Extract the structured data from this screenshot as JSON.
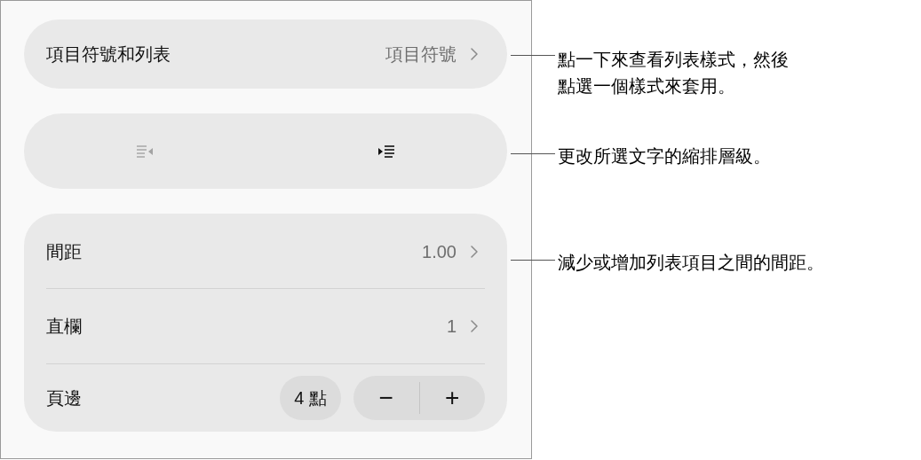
{
  "list_style": {
    "label": "項目符號和列表",
    "value": "項目符號"
  },
  "indent_buttons": [
    {
      "kind": "outdent",
      "disabled": true
    },
    {
      "kind": "indent",
      "disabled": false
    }
  ],
  "settings": [
    {
      "kind": "link",
      "label": "間距",
      "value": "1.00"
    },
    {
      "kind": "link",
      "label": "直欄",
      "value": "1"
    },
    {
      "kind": "stepper",
      "label": "頁邊",
      "value": "4 點",
      "decrement": "−",
      "increment": "+"
    }
  ],
  "callouts": [
    {
      "text": "點一下來查看列表樣式，然後點選一個樣式來套用。"
    },
    {
      "text": "更改所選文字的縮排層級。"
    },
    {
      "text": "減少或增加列表項目之間的間距。"
    }
  ]
}
